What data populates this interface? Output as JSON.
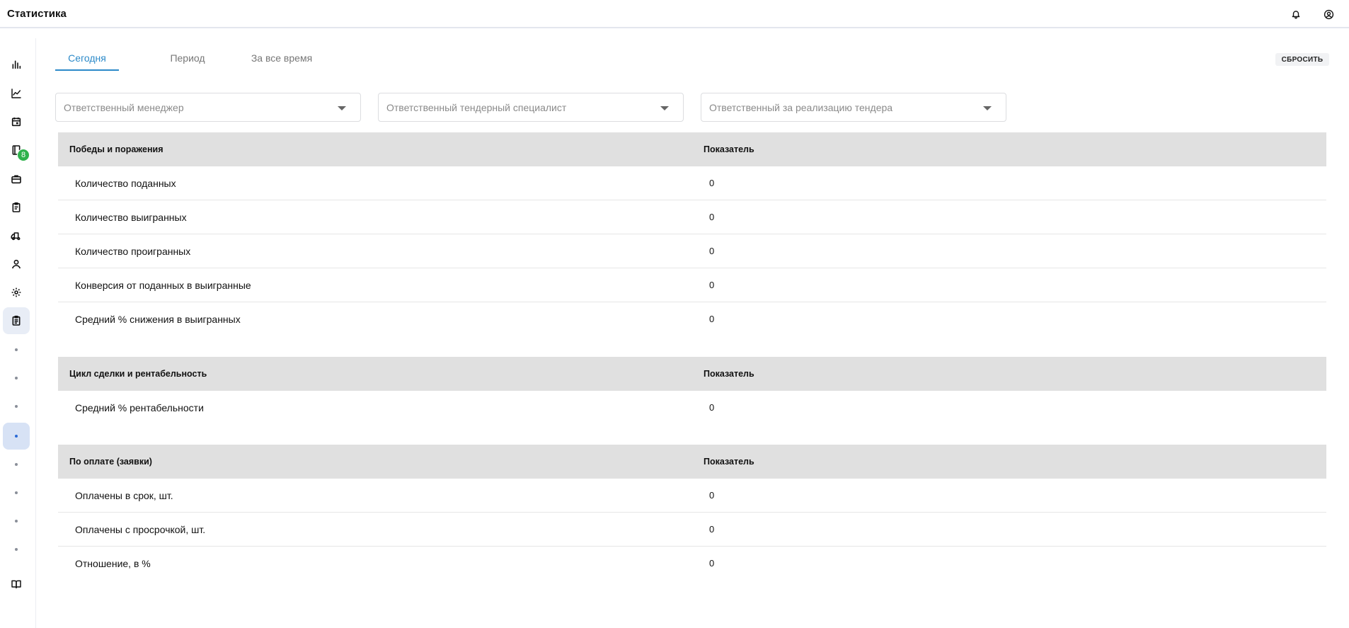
{
  "header": {
    "title": "Статистика"
  },
  "sidebar": {
    "badge_count": "8"
  },
  "tabs": [
    {
      "label": "Сегодня"
    },
    {
      "label": "Период"
    },
    {
      "label": "За все время"
    }
  ],
  "reset_label": "СБРОСИТЬ",
  "filters": [
    {
      "placeholder": "Ответственный менеджер"
    },
    {
      "placeholder": "Ответственный тендерный специалист"
    },
    {
      "placeholder": "Ответственный за реализацию тендера"
    }
  ],
  "sections": [
    {
      "title": "Победы и поражения",
      "value_header": "Показатель",
      "rows": [
        {
          "label": "Количество поданных",
          "value": "0"
        },
        {
          "label": "Количество выигранных",
          "value": "0"
        },
        {
          "label": "Количество проигранных",
          "value": "0"
        },
        {
          "label": "Конверсия от поданных в выигранные",
          "value": "0"
        },
        {
          "label": "Средний % снижения в выигранных",
          "value": "0"
        }
      ]
    },
    {
      "title": "Цикл сделки и рентабельность",
      "value_header": "Показатель",
      "rows": [
        {
          "label": "Средний % рентабельности",
          "value": "0"
        }
      ]
    },
    {
      "title": "По оплате (заявки)",
      "value_header": "Показатель",
      "rows": [
        {
          "label": "Оплачены в срок, шт.",
          "value": "0"
        },
        {
          "label": "Оплачены с просрочкой, шт.",
          "value": "0"
        },
        {
          "label": "Отношение, в %",
          "value": "0"
        }
      ]
    }
  ]
}
